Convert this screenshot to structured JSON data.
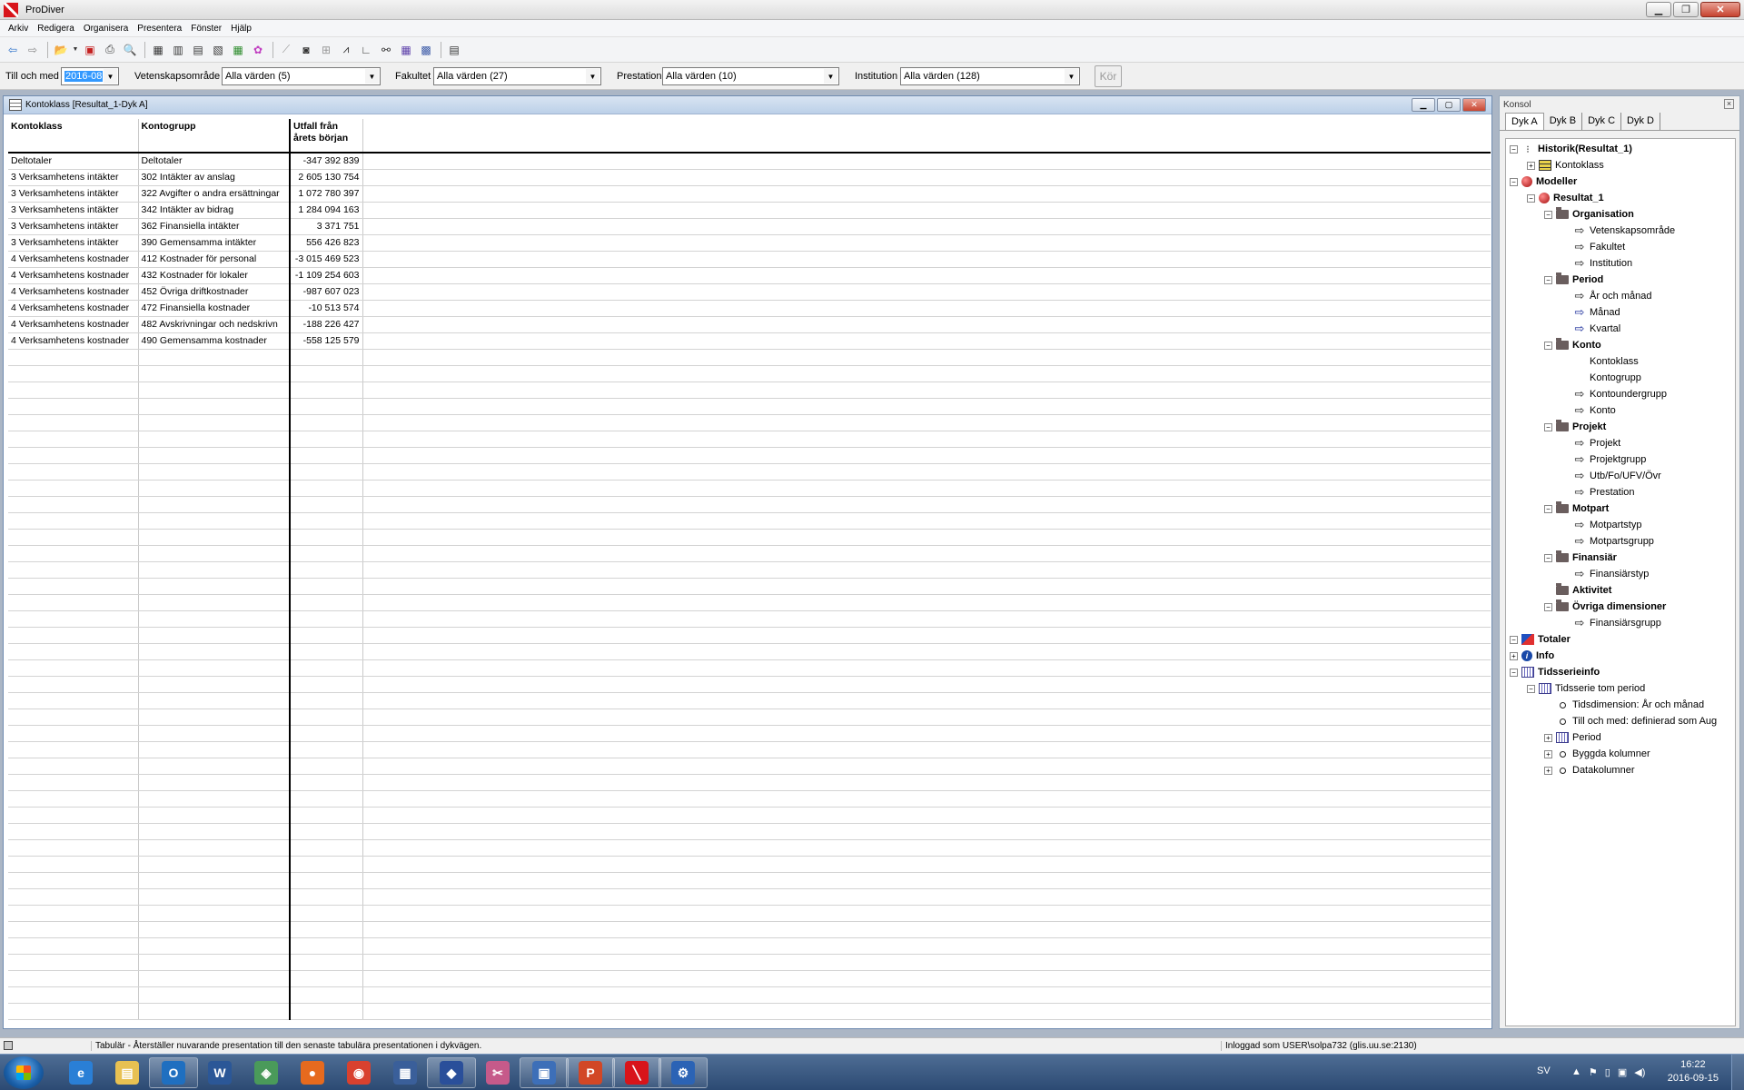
{
  "window": {
    "title": "ProDiver"
  },
  "menu": [
    "Arkiv",
    "Redigera",
    "Organisera",
    "Presentera",
    "Fönster",
    "Hjälp"
  ],
  "filters": {
    "period": {
      "label": "Till och med",
      "value": "2016-08"
    },
    "vetenskapsomrade": {
      "label": "Vetenskapsområde",
      "value": "Alla värden (5)"
    },
    "fakultet": {
      "label": "Fakultet",
      "value": "Alla värden (27)"
    },
    "prestation": {
      "label": "Prestation",
      "value": "Alla värden (10)"
    },
    "institution": {
      "label": "Institution",
      "value": "Alla värden (128)"
    },
    "run_label": "Kör"
  },
  "document": {
    "title": "Kontoklass [Resultat_1-Dyk A]",
    "columns": [
      "Kontoklass",
      "Kontogrupp",
      "Utfall från årets början"
    ],
    "column3_line1": "Utfall från",
    "column3_line2": "årets början",
    "rows": [
      [
        "Deltotaler",
        "Deltotaler",
        "-347 392 839"
      ],
      [
        "3 Verksamhetens intäkter",
        "302 Intäkter av anslag",
        "2 605 130 754"
      ],
      [
        "3 Verksamhetens intäkter",
        "322 Avgifter o andra ersättningar",
        "1 072 780 397"
      ],
      [
        "3 Verksamhetens intäkter",
        "342 Intäkter av bidrag",
        "1 284 094 163"
      ],
      [
        "3 Verksamhetens intäkter",
        "362 Finansiella intäkter",
        "3 371 751"
      ],
      [
        "3 Verksamhetens intäkter",
        "390 Gemensamma intäkter",
        "556 426 823"
      ],
      [
        "4 Verksamhetens kostnader",
        "412 Kostnader för personal",
        "-3 015 469 523"
      ],
      [
        "4 Verksamhetens kostnader",
        "432 Kostnader för lokaler",
        "-1 109 254 603"
      ],
      [
        "4 Verksamhetens kostnader",
        "452 Övriga driftkostnader",
        "-987 607 023"
      ],
      [
        "4 Verksamhetens kostnader",
        "472 Finansiella kostnader",
        "-10 513 574"
      ],
      [
        "4 Verksamhetens kostnader",
        "482 Avskrivningar och nedskrivn",
        "-188 226 427"
      ],
      [
        "4 Verksamhetens kostnader",
        "490 Gemensamma kostnader",
        "-558 125 579"
      ]
    ]
  },
  "console": {
    "title": "Konsol",
    "tabs": [
      "Dyk A",
      "Dyk B",
      "Dyk C",
      "Dyk D"
    ],
    "tree": [
      {
        "label": "Historik(Resultat_1)",
        "depth": 0,
        "exp": "-",
        "icon": "hist",
        "bold": true
      },
      {
        "label": "Kontoklass",
        "depth": 1,
        "exp": "+",
        "icon": "table",
        "bold": false
      },
      {
        "label": "Modeller",
        "depth": 0,
        "exp": "-",
        "icon": "ball",
        "bold": true
      },
      {
        "label": "Resultat_1",
        "depth": 1,
        "exp": "-",
        "icon": "ball",
        "bold": true
      },
      {
        "label": "Organisation",
        "depth": 2,
        "exp": "-",
        "icon": "folder",
        "bold": true
      },
      {
        "label": "Vetenskapsområde",
        "depth": 3,
        "exp": "",
        "icon": "arrow",
        "bold": false
      },
      {
        "label": "Fakultet",
        "depth": 3,
        "exp": "",
        "icon": "arrow",
        "bold": false
      },
      {
        "label": "Institution",
        "depth": 3,
        "exp": "",
        "icon": "arrow",
        "bold": false
      },
      {
        "label": "Period",
        "depth": 2,
        "exp": "-",
        "icon": "folder",
        "bold": true
      },
      {
        "label": "År och månad",
        "depth": 3,
        "exp": "",
        "icon": "arrow",
        "bold": false
      },
      {
        "label": "Månad",
        "depth": 3,
        "exp": "",
        "icon": "arrow-blue",
        "bold": false
      },
      {
        "label": "Kvartal",
        "depth": 3,
        "exp": "",
        "icon": "arrow-blue",
        "bold": false
      },
      {
        "label": "Konto",
        "depth": 2,
        "exp": "-",
        "icon": "folder",
        "bold": true
      },
      {
        "label": "Kontoklass",
        "depth": 3,
        "exp": "",
        "icon": "none",
        "bold": false
      },
      {
        "label": "Kontogrupp",
        "depth": 3,
        "exp": "",
        "icon": "none",
        "bold": false
      },
      {
        "label": "Kontoundergrupp",
        "depth": 3,
        "exp": "",
        "icon": "arrow",
        "bold": false
      },
      {
        "label": "Konto",
        "depth": 3,
        "exp": "",
        "icon": "arrow",
        "bold": false
      },
      {
        "label": "Projekt",
        "depth": 2,
        "exp": "-",
        "icon": "folder",
        "bold": true
      },
      {
        "label": "Projekt",
        "depth": 3,
        "exp": "",
        "icon": "arrow",
        "bold": false
      },
      {
        "label": "Projektgrupp",
        "depth": 3,
        "exp": "",
        "icon": "arrow",
        "bold": false
      },
      {
        "label": "Utb/Fo/UFV/Övr",
        "depth": 3,
        "exp": "",
        "icon": "arrow",
        "bold": false
      },
      {
        "label": "Prestation",
        "depth": 3,
        "exp": "",
        "icon": "arrow",
        "bold": false
      },
      {
        "label": "Motpart",
        "depth": 2,
        "exp": "-",
        "icon": "folder",
        "bold": true
      },
      {
        "label": "Motpartstyp",
        "depth": 3,
        "exp": "",
        "icon": "arrow",
        "bold": false
      },
      {
        "label": "Motpartsgrupp",
        "depth": 3,
        "exp": "",
        "icon": "arrow",
        "bold": false
      },
      {
        "label": "Finansiär",
        "depth": 2,
        "exp": "-",
        "icon": "folder",
        "bold": true
      },
      {
        "label": "Finansiärstyp",
        "depth": 3,
        "exp": "",
        "icon": "arrow",
        "bold": false
      },
      {
        "label": "Aktivitet",
        "depth": 2,
        "exp": "",
        "icon": "folder",
        "bold": true
      },
      {
        "label": "Övriga dimensioner",
        "depth": 2,
        "exp": "-",
        "icon": "folder",
        "bold": true
      },
      {
        "label": "Finansiärsgrupp",
        "depth": 3,
        "exp": "",
        "icon": "arrow",
        "bold": false
      },
      {
        "label": "Totaler",
        "depth": 0,
        "exp": "-",
        "icon": "totals",
        "bold": true
      },
      {
        "label": "Info",
        "depth": 0,
        "exp": "+",
        "icon": "info",
        "bold": true
      },
      {
        "label": "Tidsserieinfo",
        "depth": 0,
        "exp": "-",
        "icon": "calendar",
        "bold": true
      },
      {
        "label": "Tidsserie tom period",
        "depth": 1,
        "exp": "-",
        "icon": "calendar",
        "bold": false
      },
      {
        "label": "Tidsdimension: År och månad",
        "depth": 2,
        "exp": "",
        "icon": "dot",
        "bold": false
      },
      {
        "label": "Till och med: definierad som Aug",
        "depth": 2,
        "exp": "",
        "icon": "dot",
        "bold": false
      },
      {
        "label": "Period",
        "depth": 2,
        "exp": "+",
        "icon": "calendar",
        "bold": false
      },
      {
        "label": "Byggda kolumner",
        "depth": 2,
        "exp": "+",
        "icon": "dot",
        "bold": false
      },
      {
        "label": "Datakolumner",
        "depth": 2,
        "exp": "+",
        "icon": "dot",
        "bold": false
      }
    ]
  },
  "status": {
    "message": "Tabulär - Återställer nuvarande presentation till den senaste tabulära presentationen i dykvägen.",
    "user": "Inloggad som USER\\solpa732 (glis.uu.se:2130)"
  },
  "taskbar": {
    "apps": [
      {
        "name": "internet-explorer-icon",
        "glyph": "e",
        "color": "#2a7fd6",
        "active": false
      },
      {
        "name": "file-explorer-icon",
        "glyph": "▤",
        "color": "#e8c152",
        "active": false
      },
      {
        "name": "outlook-icon",
        "glyph": "O",
        "color": "#1f6fc0",
        "active": true
      },
      {
        "name": "word-icon",
        "glyph": "W",
        "color": "#2b5797",
        "active": false
      },
      {
        "name": "network-app-icon",
        "glyph": "◈",
        "color": "#4a9a5a",
        "active": false
      },
      {
        "name": "firefox-icon",
        "glyph": "●",
        "color": "#e66a1e",
        "active": false
      },
      {
        "name": "chrome-icon",
        "glyph": "◉",
        "color": "#d9412f",
        "active": false
      },
      {
        "name": "notes-app-icon",
        "glyph": "▦",
        "color": "#3a5f9a",
        "active": false
      },
      {
        "name": "cube-app-icon",
        "glyph": "◆",
        "color": "#2a4f9a",
        "active": true
      },
      {
        "name": "snipping-tool-icon",
        "glyph": "✂",
        "color": "#c65a8a",
        "active": false
      },
      {
        "name": "remote-desktop-icon",
        "glyph": "▣",
        "color": "#3d6fb8",
        "active": true
      },
      {
        "name": "powerpoint-icon",
        "glyph": "P",
        "color": "#d24726",
        "active": true
      },
      {
        "name": "prodiver-icon",
        "glyph": "╲",
        "color": "#d8141a",
        "active": true
      },
      {
        "name": "settings-app-icon",
        "glyph": "⚙",
        "color": "#2b63b5",
        "active": true
      }
    ],
    "language": "SV",
    "time": "16:22",
    "date": "2016-09-15"
  }
}
